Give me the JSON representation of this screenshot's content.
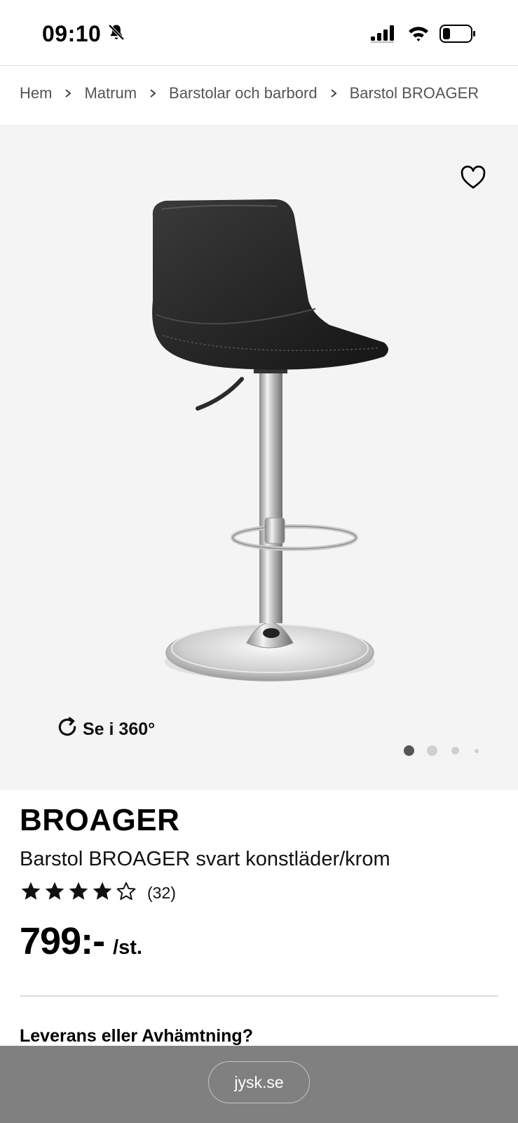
{
  "status_bar": {
    "time": "09:10",
    "icons": [
      "bell-slash-icon",
      "cellular-signal-icon",
      "wifi-icon",
      "battery-icon"
    ]
  },
  "breadcrumb": {
    "items": [
      "Hem",
      "Matrum",
      "Barstolar och barbord",
      "Barstol BROAGER"
    ],
    "separator_icon": "chevron-right-icon"
  },
  "gallery": {
    "favorite_icon": "heart-outline-icon",
    "view_360_label": "Se i 360°",
    "view_360_icon": "rotate-icon",
    "image_count": 4,
    "active_image": 1
  },
  "product": {
    "name": "BROAGER",
    "description": "Barstol BROAGER svart konstläder/krom",
    "rating": 4,
    "rating_max": 5,
    "rating_count": "(32)",
    "price": "799:-",
    "unit": "/st."
  },
  "delivery": {
    "heading": "Leverans eller Avhämtning?"
  },
  "browser": {
    "url": "jysk.se"
  },
  "colors": {
    "gallery_bg": "#f4f4f4",
    "browser_bar_bg": "#808080",
    "text": "#111111"
  }
}
